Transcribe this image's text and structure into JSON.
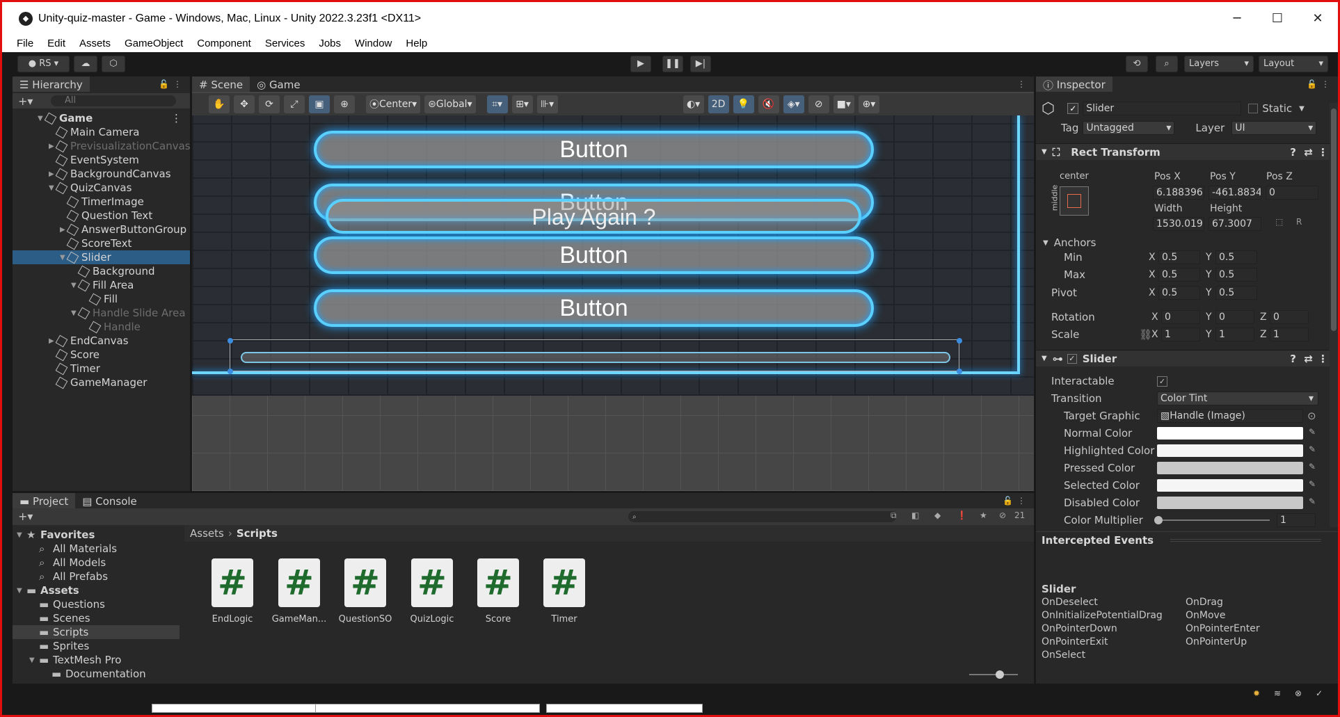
{
  "window": {
    "title": "Unity-quiz-master - Game - Windows, Mac, Linux - Unity 2022.3.23f1 <DX11>"
  },
  "menu": [
    "File",
    "Edit",
    "Assets",
    "GameObject",
    "Component",
    "Services",
    "Jobs",
    "Window",
    "Help"
  ],
  "toolbar": {
    "account": "RS",
    "layers": "Layers",
    "layout": "Layout"
  },
  "hierarchy": {
    "tab": "Hierarchy",
    "search_placeholder": "All",
    "items": [
      {
        "label": "Game",
        "depth": 0,
        "arrow": "▼",
        "bold": true
      },
      {
        "label": "Main Camera",
        "depth": 1
      },
      {
        "label": "PrevisualizationCanvas",
        "depth": 1,
        "arrow": "▶",
        "dim": true
      },
      {
        "label": "EventSystem",
        "depth": 1
      },
      {
        "label": "BackgroundCanvas",
        "depth": 1,
        "arrow": "▶"
      },
      {
        "label": "QuizCanvas",
        "depth": 1,
        "arrow": "▼"
      },
      {
        "label": "TimerImage",
        "depth": 2
      },
      {
        "label": "Question Text",
        "depth": 2
      },
      {
        "label": "AnswerButtonGroup",
        "depth": 2,
        "arrow": "▶"
      },
      {
        "label": "ScoreText",
        "depth": 2
      },
      {
        "label": "Slider",
        "depth": 2,
        "arrow": "▼",
        "selected": true
      },
      {
        "label": "Background",
        "depth": 3
      },
      {
        "label": "Fill Area",
        "depth": 3,
        "arrow": "▼"
      },
      {
        "label": "Fill",
        "depth": 4
      },
      {
        "label": "Handle Slide Area",
        "depth": 3,
        "arrow": "▼",
        "dim": true
      },
      {
        "label": "Handle",
        "depth": 4,
        "dim": true
      },
      {
        "label": "EndCanvas",
        "depth": 1,
        "arrow": "▶"
      },
      {
        "label": "Score",
        "depth": 1
      },
      {
        "label": "Timer",
        "depth": 1
      },
      {
        "label": "GameManager",
        "depth": 1
      }
    ]
  },
  "scene": {
    "tabs": [
      "Scene",
      "Game"
    ],
    "pivot": "Center",
    "space": "Global",
    "mode2d": "2D",
    "buttons": [
      "Button",
      "Button",
      "Button",
      "Button"
    ],
    "play_again": "Play Again ?"
  },
  "inspector": {
    "tab": "Inspector",
    "object_name": "Slider",
    "static_label": "Static",
    "tag_label": "Tag",
    "tag": "Untagged",
    "layer_label": "Layer",
    "layer": "UI",
    "rect_transform": {
      "title": "Rect Transform",
      "anchor_h": "center",
      "anchor_v": "middle",
      "posx_label": "Pos X",
      "posy_label": "Pos Y",
      "posz_label": "Pos Z",
      "posx": "6.188396",
      "posy": "-461.8834",
      "posz": "0",
      "width_label": "Width",
      "height_label": "Height",
      "width": "1530.019",
      "height": "67.3007",
      "anchors_label": "Anchors",
      "min_label": "Min",
      "max_label": "Max",
      "pivot_label": "Pivot",
      "min_x": "0.5",
      "min_y": "0.5",
      "max_x": "0.5",
      "max_y": "0.5",
      "pivot_x": "0.5",
      "pivot_y": "0.5",
      "rotation_label": "Rotation",
      "rot_x": "0",
      "rot_y": "0",
      "rot_z": "0",
      "scale_label": "Scale",
      "scale_x": "1",
      "scale_y": "1",
      "scale_z": "1",
      "x": "X",
      "y": "Y",
      "z": "Z"
    },
    "slider": {
      "title": "Slider",
      "interactable_label": "Interactable",
      "transition_label": "Transition",
      "transition": "Color Tint",
      "target_graphic_label": "Target Graphic",
      "target_graphic": "Handle (Image)",
      "normal_label": "Normal Color",
      "highlighted_label": "Highlighted Color",
      "pressed_label": "Pressed Color",
      "selected_label": "Selected Color",
      "disabled_label": "Disabled Color",
      "multiplier_label": "Color Multiplier",
      "multiplier": "1",
      "normal_color": "#ffffff",
      "highlighted_color": "#f5f5f5",
      "pressed_color": "#c8c8c8",
      "selected_color": "#f5f5f5",
      "disabled_color": "#c8c8c8"
    },
    "events": {
      "title": "Intercepted Events",
      "component": "Slider",
      "left": [
        "OnDeselect",
        "OnInitializePotentialDrag",
        "OnPointerDown",
        "OnPointerExit",
        "OnSelect"
      ],
      "right": [
        "OnDrag",
        "OnMove",
        "OnPointerEnter",
        "OnPointerUp"
      ]
    }
  },
  "project": {
    "tabs": [
      "Project",
      "Console"
    ],
    "hidden_count": "21",
    "tree": [
      {
        "label": "Favorites",
        "depth": 0,
        "arrow": "▼",
        "bold": true
      },
      {
        "label": "All Materials",
        "depth": 1
      },
      {
        "label": "All Models",
        "depth": 1
      },
      {
        "label": "All Prefabs",
        "depth": 1
      },
      {
        "label": "Assets",
        "depth": 0,
        "arrow": "▼",
        "bold": true
      },
      {
        "label": "Questions",
        "depth": 1
      },
      {
        "label": "Scenes",
        "depth": 1
      },
      {
        "label": "Scripts",
        "depth": 1,
        "selected": true
      },
      {
        "label": "Sprites",
        "depth": 1
      },
      {
        "label": "TextMesh Pro",
        "depth": 1,
        "arrow": "▼"
      },
      {
        "label": "Documentation",
        "depth": 2
      }
    ],
    "breadcrumb": [
      "Assets",
      "Scripts"
    ],
    "assets": [
      "EndLogic",
      "GameMan...",
      "QuestionSO",
      "QuizLogic",
      "Score",
      "Timer"
    ]
  }
}
